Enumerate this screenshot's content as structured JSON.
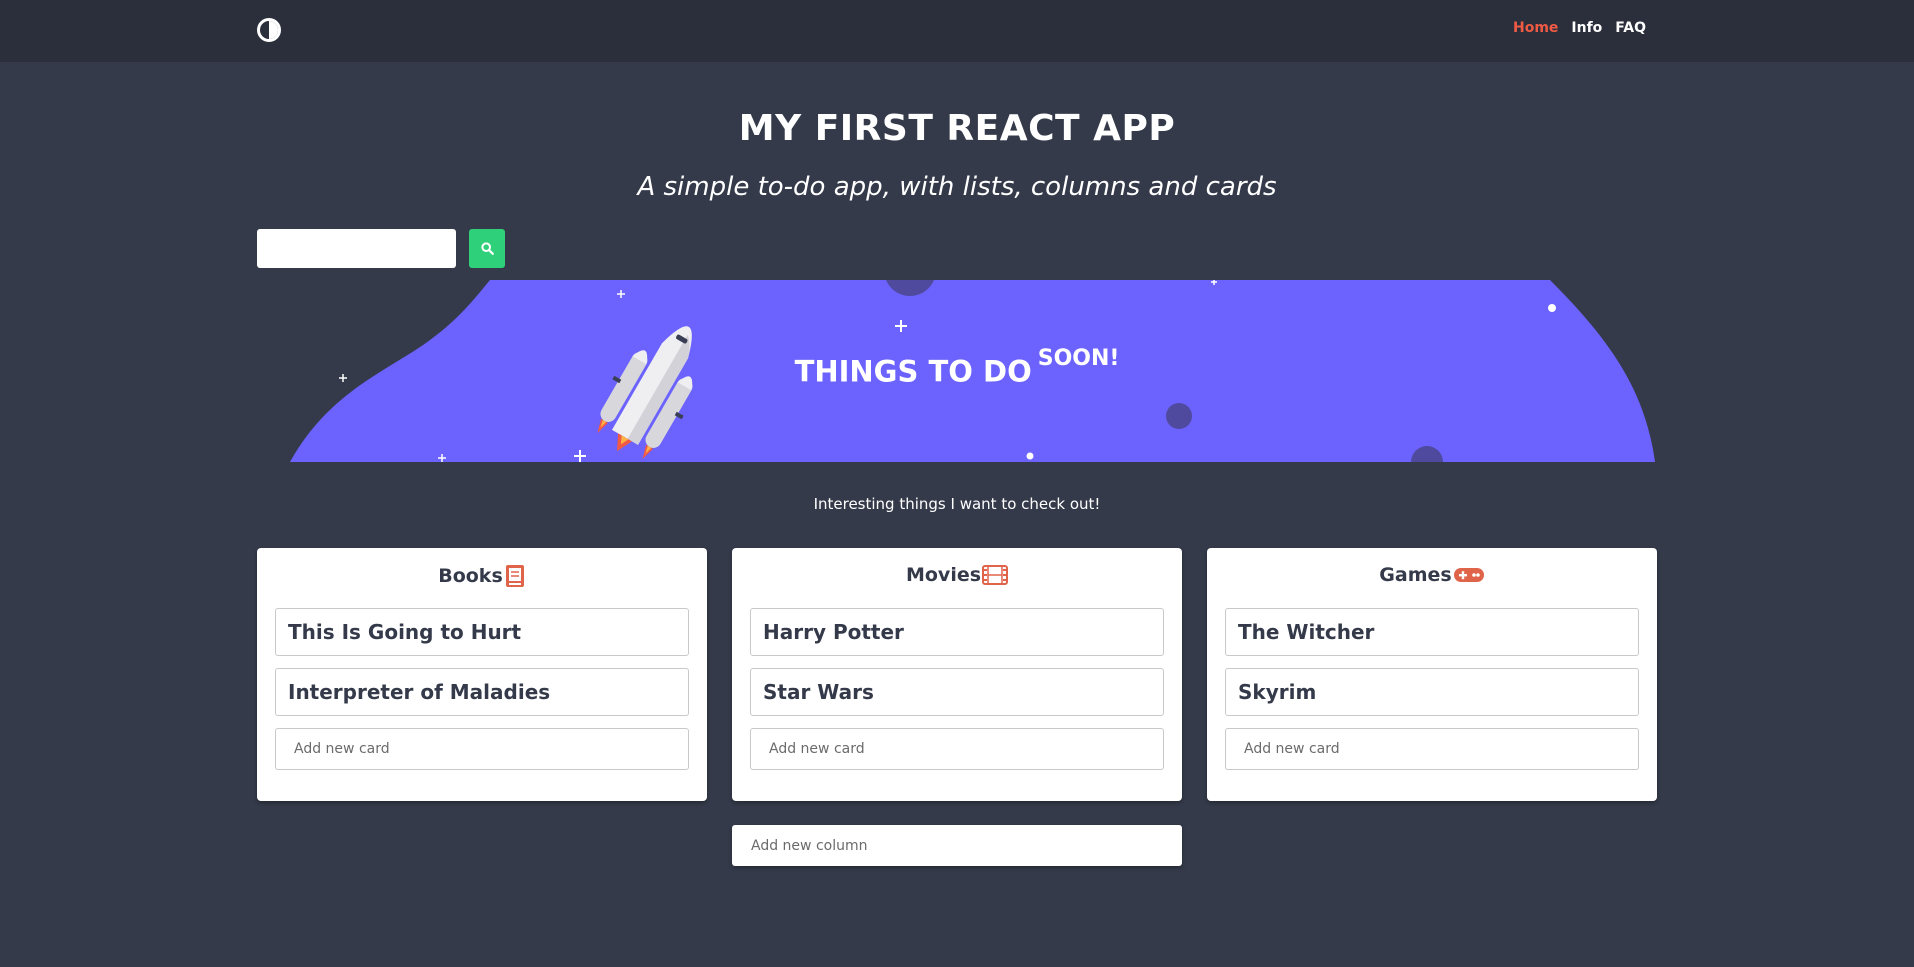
{
  "nav": {
    "logo_icon": "contrast-toggle-icon",
    "links": [
      {
        "label": "Home",
        "active": true
      },
      {
        "label": "Info",
        "active": false
      },
      {
        "label": "FAQ",
        "active": false
      }
    ]
  },
  "hero": {
    "title": "MY FIRST REACT APP",
    "subtitle": "A simple to-do app, with lists, columns and cards"
  },
  "search": {
    "placeholder": "",
    "button_icon": "search-icon"
  },
  "banner": {
    "title": "THINGS TO DO",
    "title_sup": "SOON!",
    "image": "rocket-illustration"
  },
  "tagline": "Interesting things I want to check out!",
  "columns": [
    {
      "title": "Books",
      "icon": "book-icon",
      "cards": [
        "This Is Going to Hurt",
        "Interpreter of Maladies"
      ],
      "add_placeholder": "Add new card"
    },
    {
      "title": "Movies",
      "icon": "film-icon",
      "cards": [
        "Harry Potter",
        "Star Wars"
      ],
      "add_placeholder": "Add new card"
    },
    {
      "title": "Games",
      "icon": "gamepad-icon",
      "cards": [
        "The Witcher",
        "Skyrim"
      ],
      "add_placeholder": "Add new card"
    }
  ],
  "add_column_placeholder": "Add new column",
  "colors": {
    "background": "#343a4a",
    "navbar": "#2b2f3b",
    "accent": "#f05a44",
    "banner": "#6c63ff",
    "search_button": "#2ed07a"
  }
}
